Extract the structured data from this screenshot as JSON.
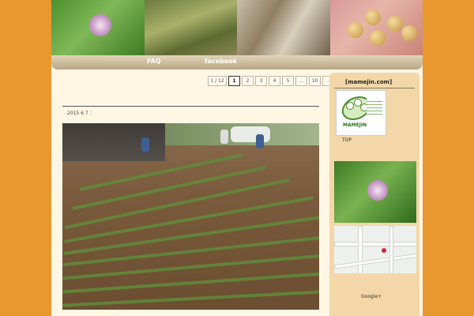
{
  "nav": {
    "items": [
      "FAQ",
      "facebook"
    ]
  },
  "pager": {
    "first": "1 / 12",
    "pages": [
      "1",
      "2",
      "3",
      "4",
      "5",
      "...",
      "10",
      "...",
      "»",
      "»"
    ],
    "current": "1"
  },
  "post": {
    "date": "2015 6 7  ："
  },
  "sidebar": {
    "title": "[mamejin.com]",
    "logo_text": "MAMEJIN",
    "top_link": "TOP",
    "google_plus": "Google+"
  },
  "colors": {
    "background": "#e9982f",
    "page": "#fff6e4",
    "sidebar": "#f3d7a8"
  }
}
